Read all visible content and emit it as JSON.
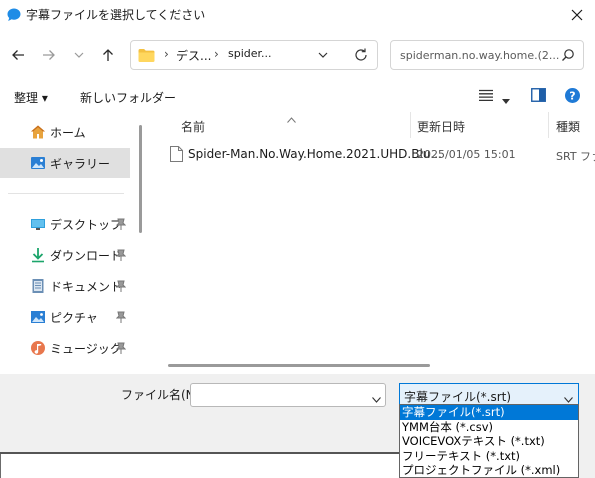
{
  "window": {
    "title": "字幕ファイルを選択してください",
    "icon": "speech-bubble-icon",
    "close_icon": "close-icon"
  },
  "nav": {
    "back_icon": "arrow-left-icon",
    "forward_icon": "arrow-right-icon",
    "recent_icon": "chevron-down-icon",
    "up_icon": "arrow-up-icon",
    "address": {
      "separator": "›",
      "segments": [
        "デス...",
        "spider..."
      ],
      "folder_icon": "folder-icon",
      "dropdown_icon": "chevron-down-icon",
      "refresh_icon": "refresh-icon"
    },
    "search": {
      "text": "spiderman.no.way.home.(2...",
      "icon": "search-icon"
    }
  },
  "toolbar": {
    "organize_label": "整理 ▾",
    "new_folder_label": "新しいフォルダー"
  },
  "sidebar": {
    "items": [
      {
        "label": "ホーム",
        "icon": "home-icon",
        "pinned": false
      },
      {
        "label": "ギャラリー",
        "icon": "gallery-icon",
        "pinned": false,
        "selected": true
      },
      {
        "label": "デスクトップ",
        "icon": "desktop-icon",
        "pinned": true
      },
      {
        "label": "ダウンロード",
        "icon": "download-icon",
        "pinned": true
      },
      {
        "label": "ドキュメント",
        "icon": "document-icon",
        "pinned": true
      },
      {
        "label": "ピクチャ",
        "icon": "picture-icon",
        "pinned": true
      },
      {
        "label": "ミュージック",
        "icon": "music-icon",
        "pinned": true
      }
    ]
  },
  "file_list": {
    "columns": [
      "名前",
      "更新日時",
      "種類"
    ],
    "rows": [
      {
        "name": "Spider-Man.No.Way.Home.2021.UHD.Blu...",
        "modified": "2025/01/05 15:01",
        "type": "SRT ファ"
      }
    ]
  },
  "bottom": {
    "file_name_label": "ファイル名(N):",
    "file_name_value": "",
    "file_type_selected": "字幕ファイル(*.srt)",
    "file_type_options": [
      "字幕ファイル(*.srt)",
      "YMM台本 (*.csv)",
      "VOICEVOXテキスト (*.txt)",
      "フリーテキスト (*.txt)",
      "プロジェクトファイル (*.xml)"
    ]
  },
  "colors": {
    "accent": "#0078d7",
    "selection_bg": "#e5f1fb",
    "sidebar_selected": "#e0e0e0",
    "bottom_panel": "#f0f0f0"
  }
}
